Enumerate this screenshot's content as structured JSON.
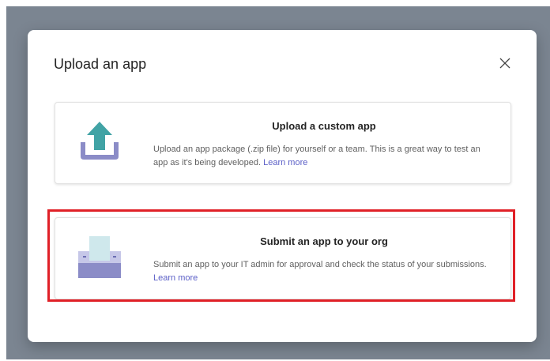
{
  "dialog": {
    "title": "Upload an app",
    "close_icon": "close-icon"
  },
  "options": [
    {
      "title": "Upload a custom app",
      "description": "Upload an app package (.zip file) for yourself or a team. This is a great way to test an app as it's being developed.",
      "link": "Learn more",
      "icon": "upload-icon"
    },
    {
      "title": "Submit an app to your org",
      "description": "Submit an app to your IT admin for approval and check the status of your submissions.",
      "link": "Learn more",
      "icon": "submit-tray-icon"
    }
  ],
  "colors": {
    "overlay": "#7b8591",
    "accent": "#5b5fc7",
    "upload_arrow": "#41a3a5",
    "tray": "#8b8cc7",
    "highlight": "#e02027"
  }
}
